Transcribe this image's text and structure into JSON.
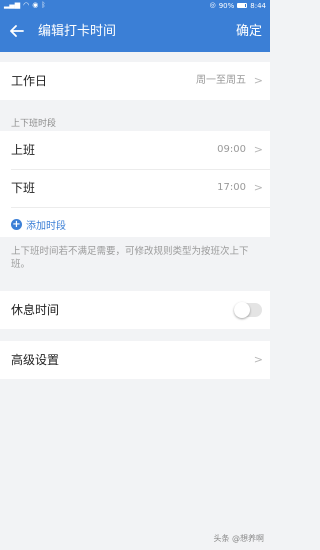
{
  "status_bar": {
    "battery": "90%",
    "time": "8:44",
    "battery_level": 0.9
  },
  "header": {
    "back_icon": "arrow-left-icon",
    "title": "编辑打卡时间",
    "confirm_label": "确定",
    "background_color": "#3b7fd6"
  },
  "workday": {
    "label": "工作日",
    "value": "周一至周五"
  },
  "shift_section": {
    "label": "上下班时段",
    "rows": [
      {
        "label": "上班",
        "value": "09:00"
      },
      {
        "label": "下班",
        "value": "17:00"
      }
    ],
    "add_label": "添加时段"
  },
  "hint": "上下班时间若不满足需要，可修改规则类型为按班次上下班。",
  "rest_time": {
    "label": "休息时间",
    "enabled": false
  },
  "advanced": {
    "label": "高级设置"
  },
  "watermark": "头条 @想养啊"
}
